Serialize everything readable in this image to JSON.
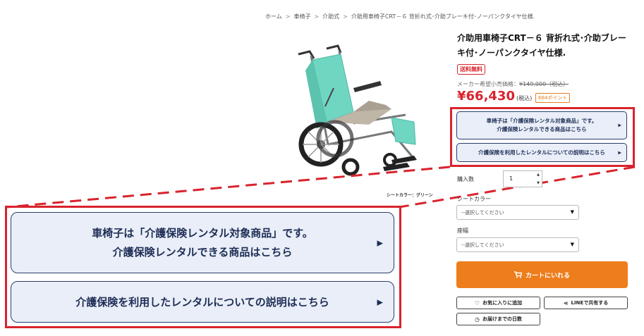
{
  "breadcrumb": {
    "items": [
      "ホーム",
      "車椅子",
      "介助式",
      "介助用車椅子CRT－６ 背折れ式･介助ブレーキ付･ノーパンクタイヤ仕様."
    ],
    "separator": ">"
  },
  "product": {
    "title": "介助用車椅子CRT－６ 背折れ式･介助ブレーキ付･ノーパンクタイヤ仕様.",
    "free_shipping_badge": "送料無料",
    "list_price_label": "メーカー希望小売価格：",
    "list_price_value": "¥149,000（税込）",
    "price": "¥66,430",
    "tax_label": "(税込)",
    "points": "664ポイント",
    "seat_color_caption": "シートカラー：グリーン"
  },
  "rental_buttons": {
    "line1": "車椅子は「介護保険レンタル対象商品」です。",
    "line2": "介護保険レンタルできる商品はこちら",
    "explain": "介護保険を利用したレンタルについての説明はこちら"
  },
  "form": {
    "quantity_label": "購入数",
    "quantity_value": "1",
    "seat_color_label": "シートカラー",
    "seat_color_placeholder": "--選択してください",
    "seat_width_label": "座幅",
    "seat_width_placeholder": "--選択してください"
  },
  "actions": {
    "add_to_cart": "カートにいれる",
    "favorite": "お気に入りに追加",
    "share_line": "LINEで共有する",
    "delivery_days": "お届けまでの日数"
  },
  "colors": {
    "accent_red": "#d9232d",
    "cart_orange": "#ee7d1c",
    "button_navy": "#1d2d55",
    "button_bg": "#e9eef8",
    "seat_green": "#6fd6c2"
  }
}
